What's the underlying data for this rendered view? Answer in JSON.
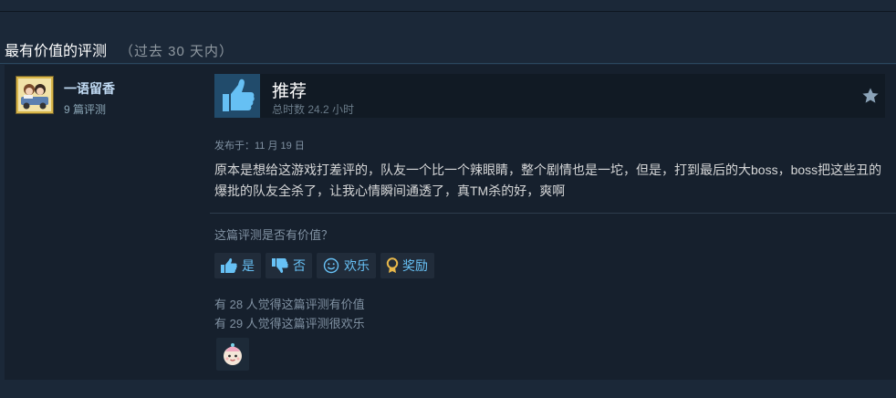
{
  "section": {
    "title": "最有价值的评测",
    "subtitle": "（过去 30 天内）"
  },
  "review": {
    "author": {
      "name": "一语留香",
      "review_count": "9 篇评测",
      "avatar_icon": "avatar-cartoon-car-icon"
    },
    "vote": {
      "label": "推荐",
      "hours": "总时数 24.2 小时",
      "icon": "thumbs-up-icon"
    },
    "posted": "发布于：11 月 19 日",
    "text": "原本是想给这游戏打差评的，队友一个比一个辣眼睛，整个剧情也是一坨，但是，打到最后的大boss，boss把这些丑的爆批的队友全杀了，让我心情瞬间通透了，真TM杀的好，爽啊",
    "helpful_question": "这篇评测是否有价值？",
    "buttons": {
      "yes": "是",
      "no": "否",
      "funny": "欢乐",
      "award": "奖励"
    },
    "stats": {
      "helpful": "有 28 人觉得这篇评测有价值",
      "funny": "有 29 人觉得这篇评测很欢乐"
    }
  },
  "colors": {
    "background": "#1b2838",
    "card": "#16202d",
    "accent_link": "#67c1f5",
    "vote_box": "#214b6b"
  }
}
